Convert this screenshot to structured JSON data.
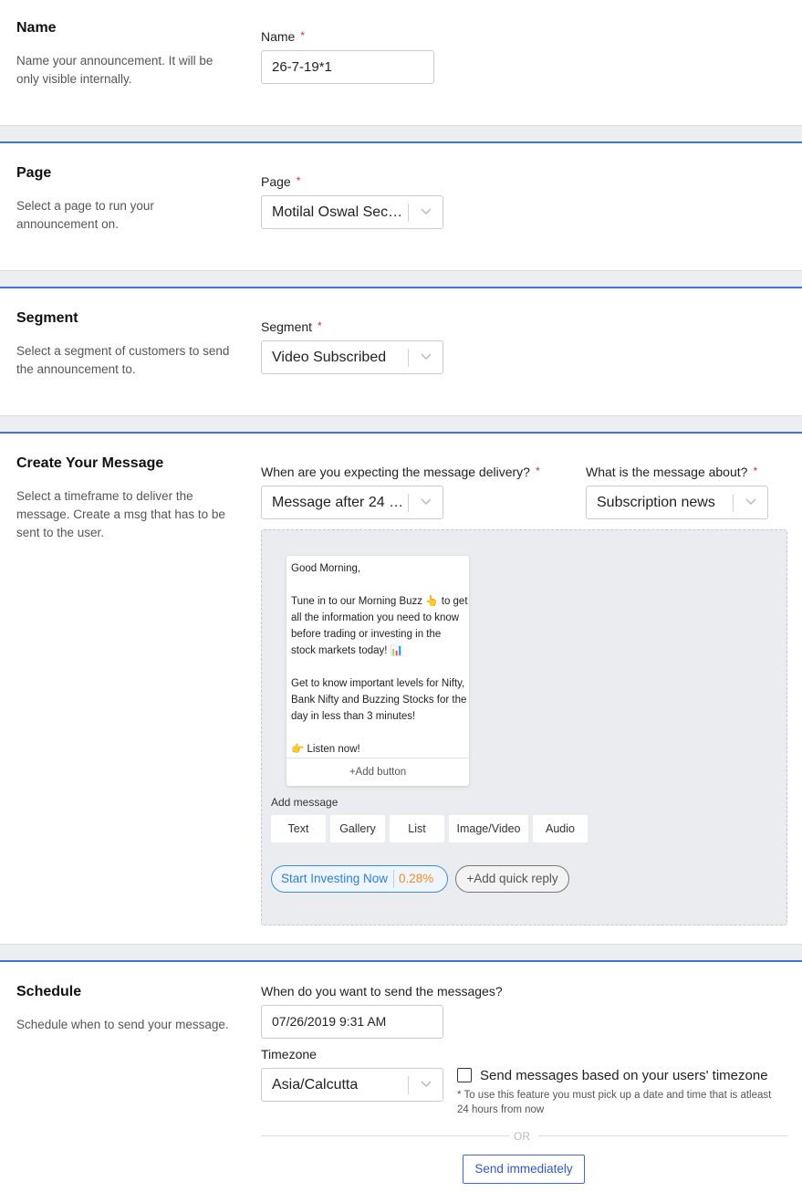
{
  "name_section": {
    "title": "Name",
    "description": "Name your announcement. It will be only visible internally.",
    "field_label": "Name",
    "required_mark": "*",
    "value": "26-7-19*1"
  },
  "page_section": {
    "title": "Page",
    "description": "Select a page to run your announcement on.",
    "field_label": "Page",
    "required_mark": "*",
    "value": "Motilal Oswal Secur..."
  },
  "segment_section": {
    "title": "Segment",
    "description": "Select a segment of customers to send the announcement to.",
    "field_label": "Segment",
    "required_mark": "*",
    "value": "Video Subscribed"
  },
  "message_section": {
    "title": "Create Your Message",
    "description": "Select a timeframe to deliver the message. Create a msg that has to be sent to the user.",
    "delivery_label": "When are you expecting the message delivery?",
    "delivery_value": "Message after 24 h...",
    "about_label": "What is the message about?",
    "about_value": "Subscription news",
    "required_mark": "*",
    "bubble_text": "Good Morning,\n\nTune in to our Morning Buzz 👆 to get all the information you need to know before trading or investing in the stock markets today! 📊\n\nGet to know important levels for Nifty, Bank Nifty and Buzzing Stocks for the day in less than 3 minutes!\n\n👉 Listen now!",
    "add_button_label": "+Add button",
    "add_message_label": "Add message",
    "types": [
      "Text",
      "Gallery",
      "List",
      "Image/Video",
      "Audio"
    ],
    "quick_reply": {
      "label": "Start Investing Now",
      "percent": "0.28%"
    },
    "add_quick_reply_label": "+Add quick reply"
  },
  "schedule_section": {
    "title": "Schedule",
    "description": "Schedule when to send your message.",
    "when_label": "When do you want to send the messages?",
    "datetime_value": "07/26/2019 9:31 AM",
    "timezone_label": "Timezone",
    "timezone_value": "Asia/Calcutta",
    "user_tz_label": "Send messages based on your users' timezone",
    "user_tz_checked": false,
    "note": "* To use this feature you must pick up a date and time that is atleast 24 hours from now",
    "or_label": "OR",
    "send_now_label": "Send immediately"
  },
  "colors": {
    "accent": "#3f75d8",
    "required": "#d9322e",
    "quick_reply_blue": "#2e7fd6",
    "percent_orange": "#f08a24"
  }
}
